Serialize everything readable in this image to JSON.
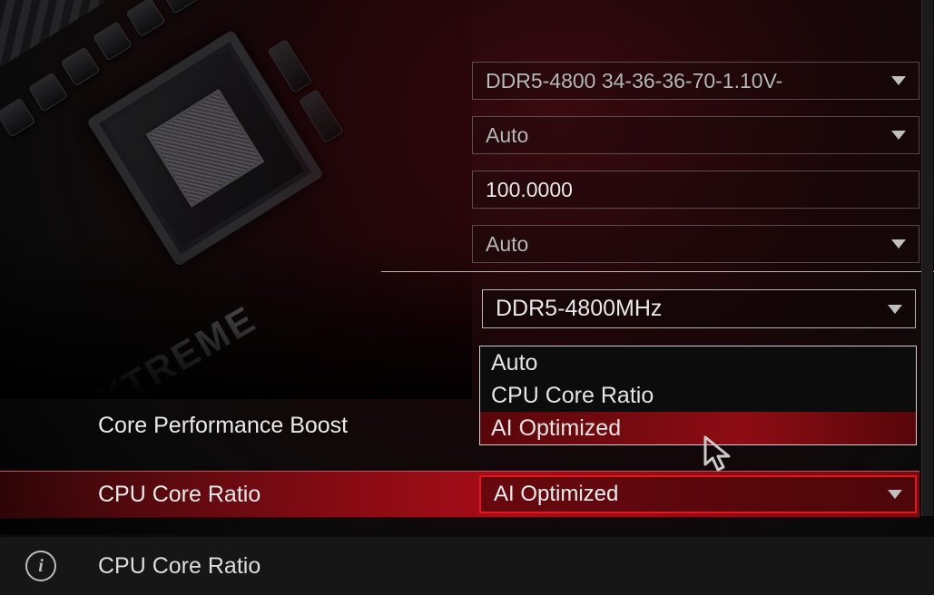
{
  "fields": {
    "mem_profile": "DDR5-4800 34-36-36-70-1.10V-",
    "bclk_mode": "Auto",
    "bclk_value": "100.0000",
    "mem_mode": "Auto"
  },
  "memory_frequency": "DDR5-4800MHz",
  "dropdown": {
    "options": [
      "Auto",
      "CPU Core Ratio",
      "AI Optimized"
    ],
    "highlighted": "AI Optimized"
  },
  "row_core_label": "Core Performance Boost",
  "row_ratio": {
    "label": "CPU Core Ratio",
    "value": "AI Optimized"
  },
  "info_bar": {
    "title": "CPU Core Ratio"
  },
  "board_text": "EXTREME"
}
